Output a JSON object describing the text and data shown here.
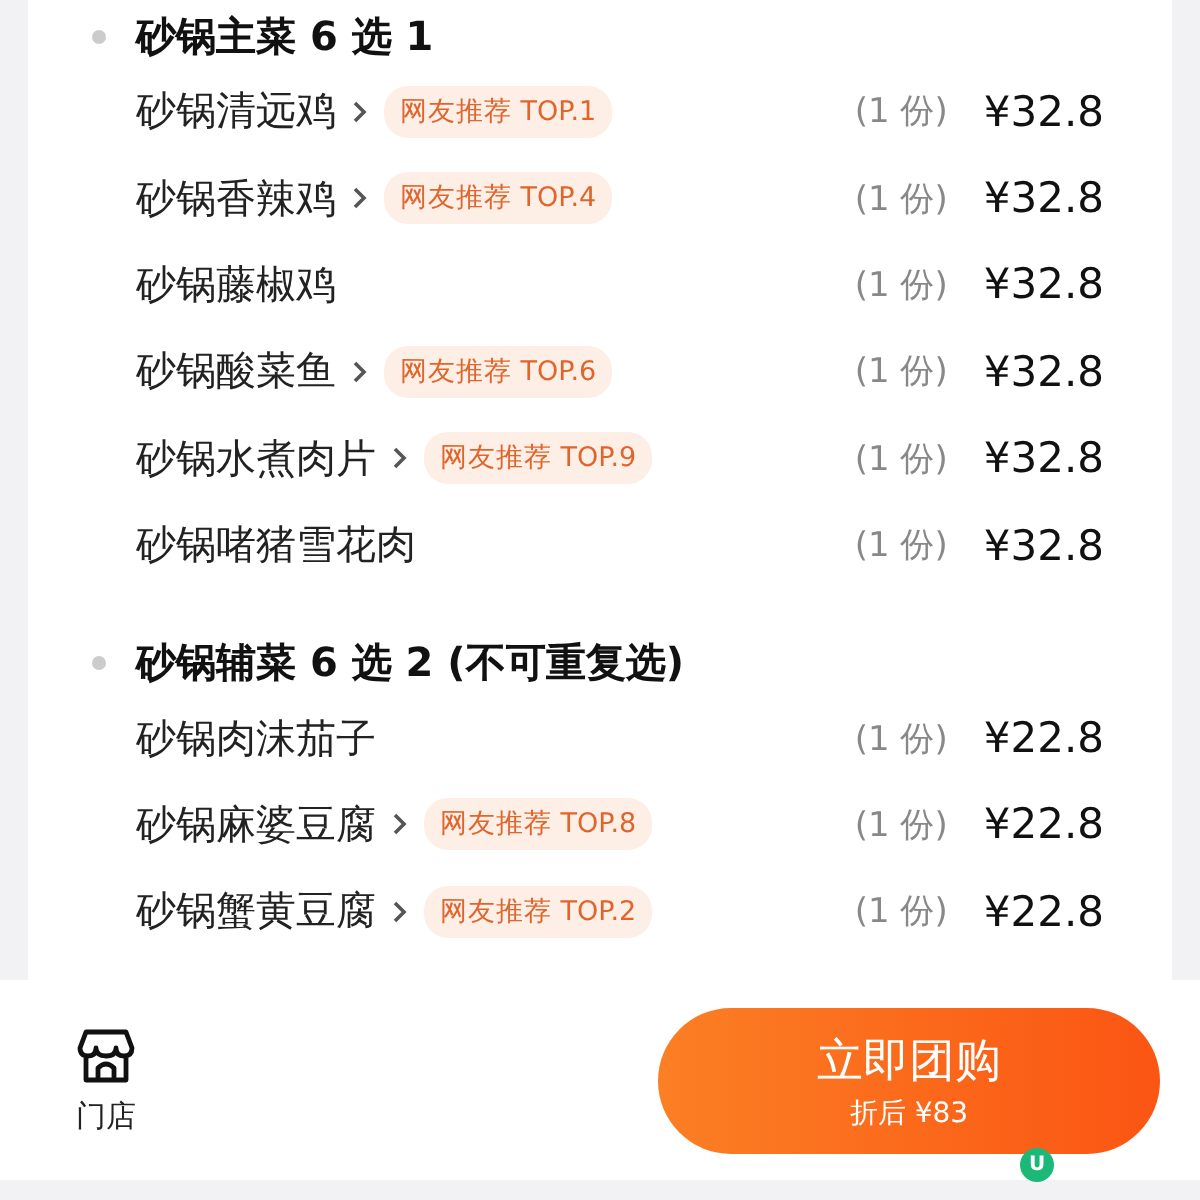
{
  "sections": [
    {
      "title": "砂锅主菜 6 选 1",
      "items": [
        {
          "name": "砂锅清远鸡",
          "has_link": true,
          "tag": "网友推荐 TOP.1",
          "qty": "(1 份)",
          "price": "¥32.8"
        },
        {
          "name": "砂锅香辣鸡",
          "has_link": true,
          "tag": "网友推荐 TOP.4",
          "qty": "(1 份)",
          "price": "¥32.8"
        },
        {
          "name": "砂锅藤椒鸡",
          "has_link": false,
          "qty": "(1 份)",
          "price": "¥32.8"
        },
        {
          "name": "砂锅酸菜鱼",
          "has_link": true,
          "tag": "网友推荐 TOP.6",
          "qty": "(1 份)",
          "price": "¥32.8"
        },
        {
          "name": "砂锅水煮肉片",
          "has_link": true,
          "tag": "网友推荐 TOP.9",
          "qty": "(1 份)",
          "price": "¥32.8"
        },
        {
          "name": "砂锅啫猪雪花肉",
          "has_link": false,
          "qty": "(1 份)",
          "price": "¥32.8"
        }
      ]
    },
    {
      "title": "砂锅辅菜 6 选 2 (不可重复选)",
      "items": [
        {
          "name": "砂锅肉沫茄子",
          "has_link": false,
          "qty": "(1 份)",
          "price": "¥22.8"
        },
        {
          "name": "砂锅麻婆豆腐",
          "has_link": true,
          "tag": "网友推荐 TOP.8",
          "qty": "(1 份)",
          "price": "¥22.8"
        },
        {
          "name": "砂锅蟹黄豆腐",
          "has_link": true,
          "tag": "网友推荐 TOP.2",
          "qty": "(1 份)",
          "price": "¥22.8"
        }
      ]
    }
  ],
  "bottom_bar": {
    "store_label": "门店",
    "buy_button": {
      "label": "立即团购",
      "subtitle": "折后 ¥83"
    },
    "badge": "U"
  }
}
